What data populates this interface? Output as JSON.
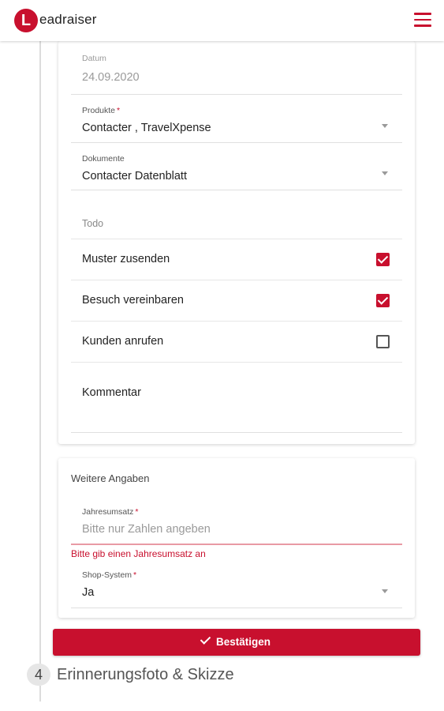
{
  "header": {
    "logo_letter": "L",
    "logo_text": "eadraiser",
    "brand_color": "#c8102e"
  },
  "form": {
    "datum": {
      "label": "Datum",
      "value": "24.09.2020"
    },
    "produkte": {
      "label": "Produkte",
      "value": "Contacter , TravelXpense",
      "required": "*"
    },
    "dokumente": {
      "label": "Dokumente",
      "value": "Contacter Datenblatt"
    },
    "todo": {
      "label": "Todo",
      "items": [
        {
          "label": "Muster zusenden",
          "checked": true
        },
        {
          "label": "Besuch vereinbaren",
          "checked": true
        },
        {
          "label": "Kunden anrufen",
          "checked": false
        }
      ]
    },
    "kommentar": {
      "label": "Kommentar"
    }
  },
  "weitere": {
    "title": "Weitere Angaben",
    "jahresumsatz": {
      "label": "Jahresumsatz",
      "required": "*",
      "placeholder": "Bitte nur Zahlen angeben",
      "error": "Bitte gib einen Jahresumsatz an"
    },
    "shop": {
      "label": "Shop-System",
      "required": "*",
      "value": "Ja"
    }
  },
  "confirm_label": "Bestätigen",
  "next_step": {
    "number": "4",
    "title": "Erinnerungsfoto & Skizze"
  }
}
